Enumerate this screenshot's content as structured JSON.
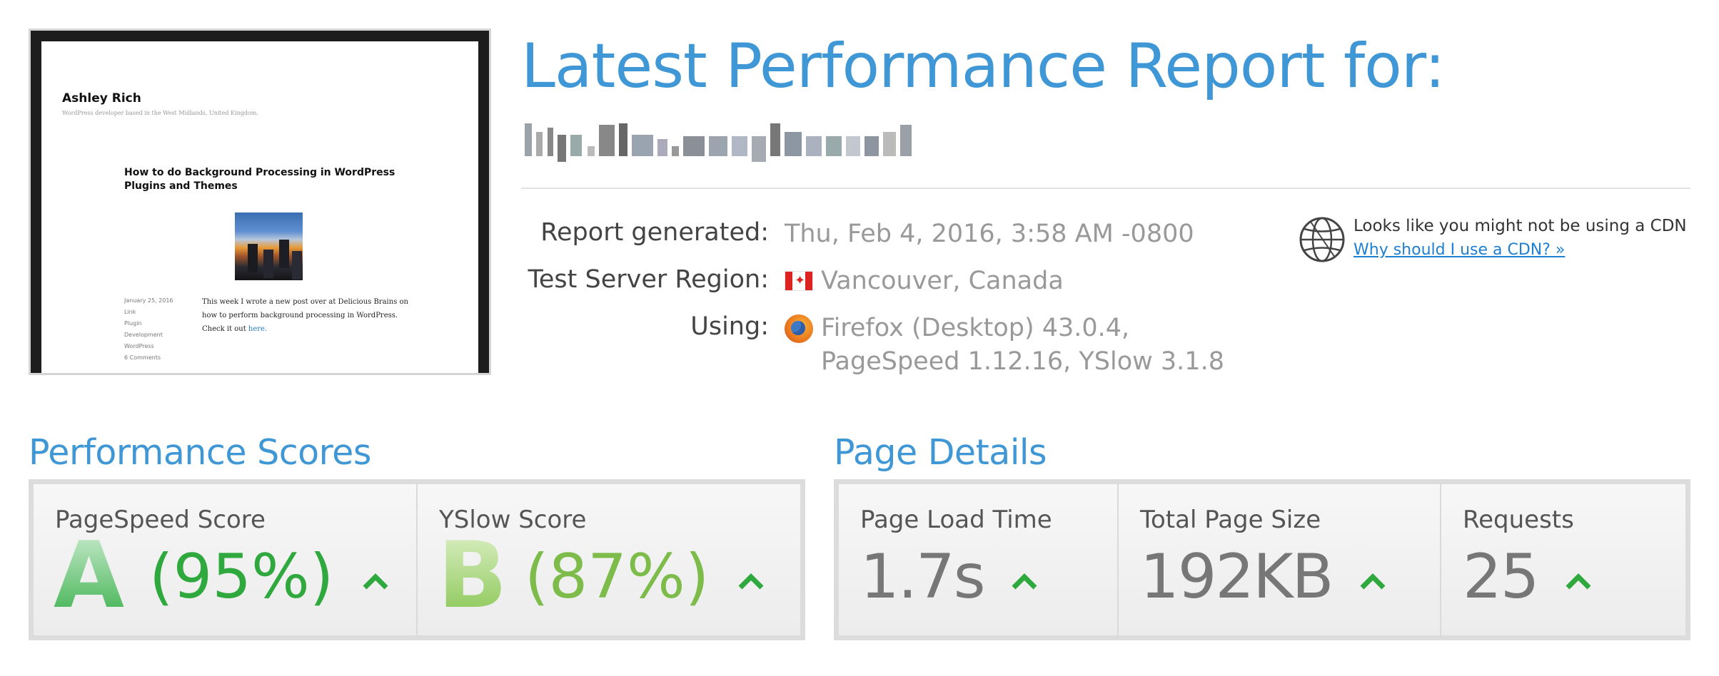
{
  "thumbnail": {
    "site_title": "Ashley Rich",
    "site_description": "WordPress developer based in the West Midlands, United Kingdom.",
    "post_title": "How to do Background Processing in WordPress Plugins and Themes",
    "meta": [
      "January 25, 2016",
      "Link",
      "Plugin",
      "Development",
      "WordPress",
      "6 Comments"
    ],
    "excerpt": "This week I wrote a new post over at Delicious Brains on how to perform background processing in WordPress. Check it out",
    "excerpt_link": "here."
  },
  "report": {
    "title": "Latest Performance Report for:",
    "generated_label": "Report generated:",
    "generated_value": "Thu, Feb 4, 2016, 3:58 AM -0800",
    "region_label": "Test Server Region:",
    "region_value": "Vancouver, Canada",
    "using_label": "Using:",
    "using_line1": "Firefox (Desktop) 43.0.4,",
    "using_line2": "PageSpeed 1.12.16, YSlow 3.1.8"
  },
  "cdn": {
    "notice": "Looks like you might not be using a CDN",
    "link": "Why should I use a CDN? »"
  },
  "performance_scores": {
    "title": "Performance Scores",
    "pagespeed": {
      "label": "PageSpeed Score",
      "grade": "A",
      "percent": "(95%)"
    },
    "yslow": {
      "label": "YSlow Score",
      "grade": "B",
      "percent": "(87%)"
    }
  },
  "page_details": {
    "title": "Page Details",
    "load_time": {
      "label": "Page Load Time",
      "value": "1.7s"
    },
    "page_size": {
      "label": "Total Page Size",
      "value": "192KB"
    },
    "requests": {
      "label": "Requests",
      "value": "25"
    }
  },
  "colors": {
    "accent": "#3f97d6",
    "grade_a": "#2fa83e",
    "grade_b": "#7dbc4b",
    "arrow": "#2fa83e"
  },
  "icons": [
    "globe-icon",
    "canada-flag-icon",
    "firefox-icon",
    "arrow-up-icon"
  ]
}
